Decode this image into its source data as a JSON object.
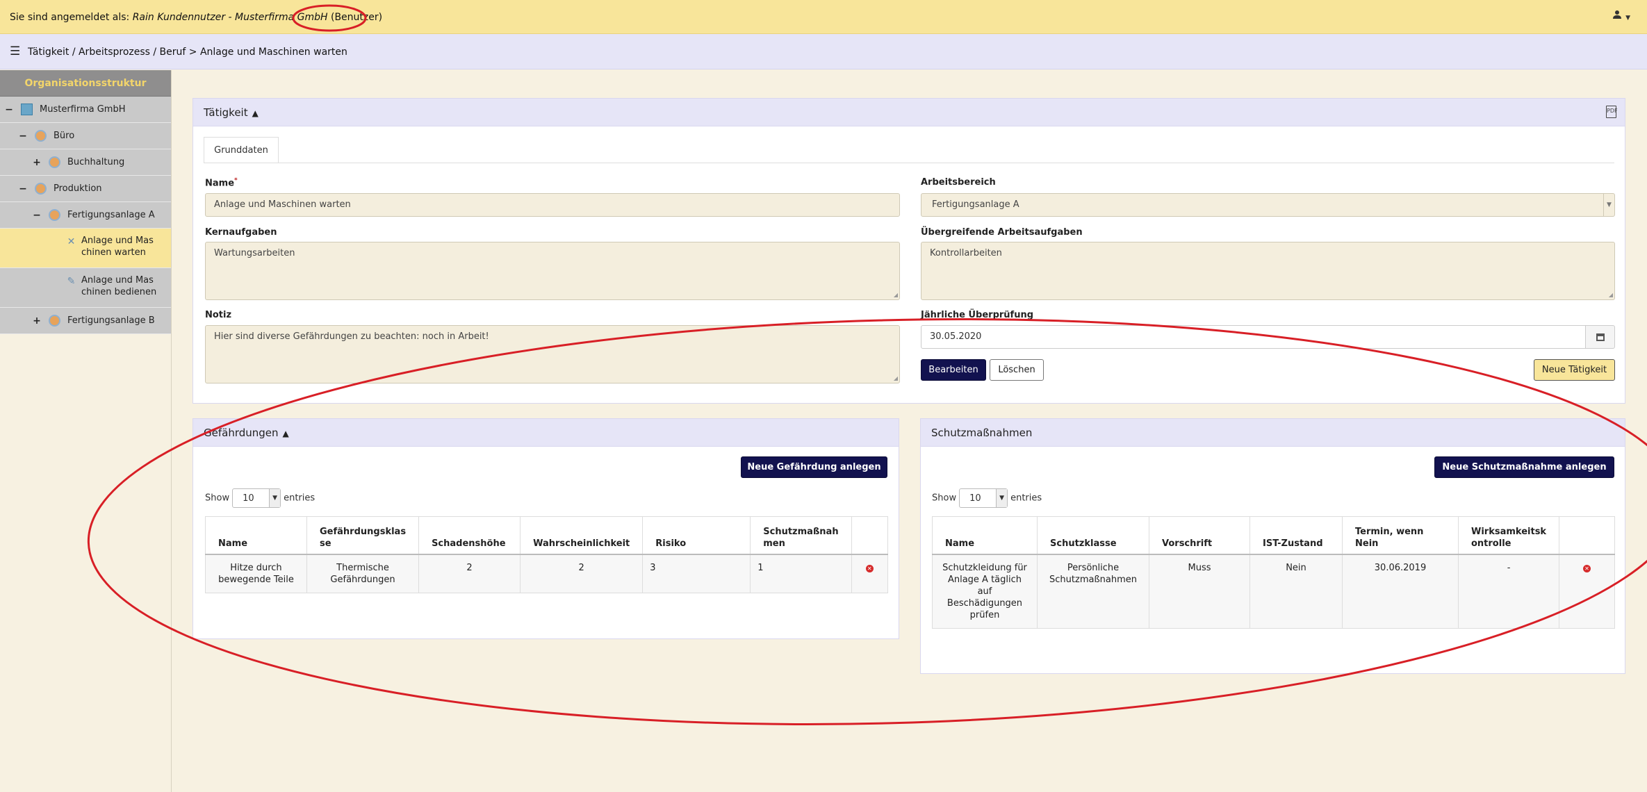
{
  "topbar": {
    "login_prefix": "Sie sind angemeldet als: ",
    "login_user": "Rain Kundennutzer - Musterfirma GmbH",
    "login_role": "(Benutzer)",
    "user_menu_icon": "user-icon"
  },
  "navbar": {
    "breadcrumb": "Tätigkeit / Arbeitsprozess / Beruf > Anlage und Maschinen warten"
  },
  "sidebar": {
    "title": "Organisationsstruktur",
    "items": [
      {
        "toggle": "−",
        "label": "Musterfirma GmbH",
        "icon": "building-icon"
      },
      {
        "toggle": "−",
        "label": "Büro",
        "icon": "group-icon"
      },
      {
        "toggle": "+",
        "label": "Buchhaltung",
        "icon": "team-icon"
      },
      {
        "toggle": "−",
        "label": "Produktion",
        "icon": "group-icon"
      },
      {
        "toggle": "−",
        "label": "Fertigungsanlage A",
        "icon": "team-icon"
      },
      {
        "toggle": "",
        "label": "Anlage und Mas chinen warten",
        "icon": "tools-icon"
      },
      {
        "toggle": "",
        "label": "Anlage und Mas chinen bedienen",
        "icon": "tools-icon"
      },
      {
        "toggle": "+",
        "label": "Fertigungsanlage B",
        "icon": "team-icon"
      }
    ]
  },
  "taetigkeit": {
    "title": "Tätigkeit",
    "tab": "Grunddaten",
    "name_label": "Name",
    "name_required": "*",
    "name_value": "Anlage und Maschinen warten",
    "kern_label": "Kernaufgaben",
    "kern_value": "Wartungsarbeiten",
    "notiz_label": "Notiz",
    "notiz_value": "Hier sind diverse Gefährdungen zu beachten: noch in Arbeit!",
    "bereich_label": "Arbeitsbereich",
    "bereich_value": "Fertigungsanlage A",
    "ueber_label": "Übergreifende Arbeitsaufgaben",
    "ueber_value": "Kontrollarbeiten",
    "pruef_label": "Jährliche Überprüfung",
    "pruef_value": "30.05.2020",
    "btn_edit": "Bearbeiten",
    "btn_delete": "Löschen",
    "btn_new": "Neue Tätigkeit"
  },
  "gefaehrdungen": {
    "title": "Gefährdungen",
    "btn_new": "Neue Gefährdung anlegen",
    "show_prefix": "Show",
    "show_value": "10",
    "show_suffix": "entries",
    "headers": [
      "Name",
      "Gefährdungsklas se",
      "Schadenshöhe",
      "Wahrscheinlichkeit",
      "Risiko",
      "Schutzmaßnah men",
      ""
    ],
    "rows": [
      [
        "Hitze durch bewegende Teile",
        "Thermische Gefährdungen",
        "2",
        "2",
        "3",
        "1"
      ]
    ]
  },
  "schutz": {
    "title": "Schutzmaßnahmen",
    "btn_new": "Neue Schutzmaßnahme anlegen",
    "show_prefix": "Show",
    "show_value": "10",
    "show_suffix": "entries",
    "headers": [
      "Name",
      "Schutzklasse",
      "Vorschrift",
      "IST-Zustand",
      "Termin, wenn Nein",
      "Wirksamkeitsk ontrolle",
      ""
    ],
    "rows": [
      [
        "Schutzkleidung für Anlage A täglich auf Beschädigungen prüfen",
        "Persönliche Schutzmaßnahmen",
        "Muss",
        "Nein",
        "30.06.2019",
        "-"
      ]
    ]
  },
  "colors": {
    "annotation": "#d81f26",
    "topbar": "#f8e59a",
    "navbar": "#e6e5f7",
    "primary_button": "#12124f"
  }
}
